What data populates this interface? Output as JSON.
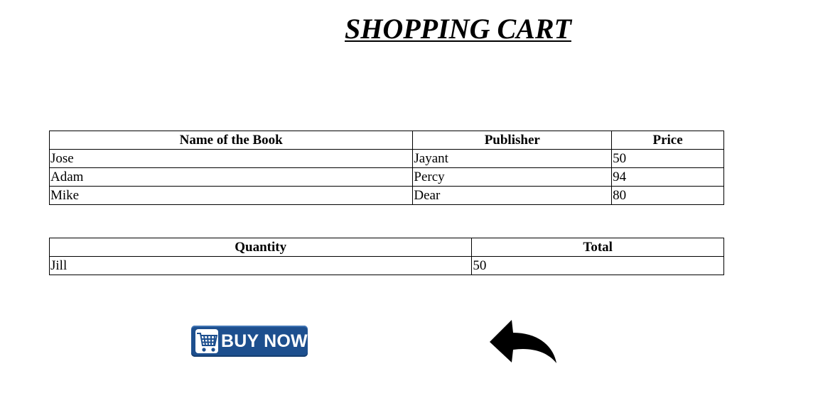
{
  "page": {
    "title": "SHOPPING CART"
  },
  "books_table": {
    "headers": [
      "Name of the Book",
      "Publisher",
      "Price"
    ],
    "rows": [
      [
        "Jose",
        "Jayant",
        "50"
      ],
      [
        "Adam",
        "Percy",
        "94"
      ],
      [
        "Mike",
        "Dear",
        "80"
      ]
    ]
  },
  "totals_table": {
    "headers": [
      "Quantity",
      "Total"
    ],
    "rows": [
      [
        "Jill",
        "50"
      ]
    ]
  },
  "actions": {
    "buy_now_label": "BUY NOW",
    "buy_now_icon": "shopping-cart-icon",
    "back_icon": "reply-arrow-icon",
    "buy_now_color": "#1d4f8e"
  }
}
